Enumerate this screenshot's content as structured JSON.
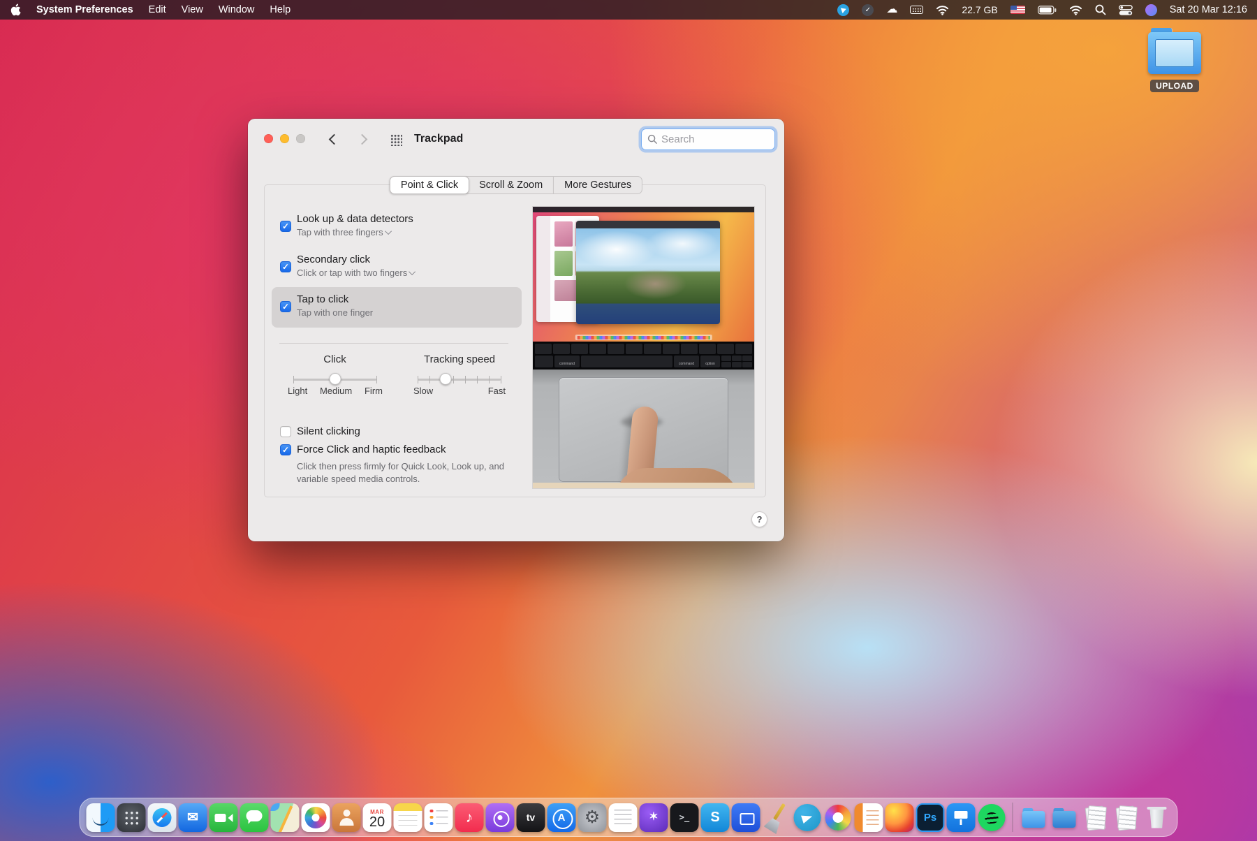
{
  "icons": {
    "check": "✓",
    "cloud": "☁"
  },
  "menu_bar": {
    "app_name": "System Preferences",
    "menus": [
      "Edit",
      "View",
      "Window",
      "Help"
    ],
    "storage": "22.7 GB",
    "clock": "Sat 20 Mar 12:16"
  },
  "desktop": {
    "upload_label": "UPLOAD"
  },
  "window": {
    "title": "Trackpad",
    "search_placeholder": "Search",
    "tabs": [
      {
        "label": "Point & Click",
        "active": true
      },
      {
        "label": "Scroll & Zoom",
        "active": false
      },
      {
        "label": "More Gestures",
        "active": false
      }
    ],
    "rows": [
      {
        "label": "Look up & data detectors",
        "detail": "Tap with three fingers",
        "checked": true
      },
      {
        "label": "Secondary click",
        "detail": "Click or tap with two fingers",
        "checked": true
      },
      {
        "label": "Tap to click",
        "detail": "Tap with one finger",
        "checked": true
      }
    ],
    "click_slider": {
      "title": "Click",
      "labels": [
        "Light",
        "Medium",
        "Firm"
      ],
      "percent": 50
    },
    "tracking_slider": {
      "title": "Tracking speed",
      "labels": [
        "Slow",
        "Fast"
      ],
      "percent": 34
    },
    "silent_clicking": {
      "label": "Silent clicking",
      "checked": false
    },
    "force_click": {
      "label": "Force Click and haptic feedback",
      "checked": true,
      "description": "Click then press firmly for Quick Look, Look up, and variable speed media controls."
    },
    "help_label": "?"
  },
  "preview": {
    "key_labels": [
      "command",
      "command",
      "option"
    ]
  },
  "dock": {
    "glyphs": {
      "mail": "✉",
      "music": "♪",
      "tv": "tv",
      "app_store": "A",
      "settings_gear": "⚙",
      "terminal": ">_",
      "skype": "S",
      "photoshop": "Ps",
      "final_cut": "✶",
      "calendar_month": "MAR",
      "calendar_day": "20"
    }
  }
}
